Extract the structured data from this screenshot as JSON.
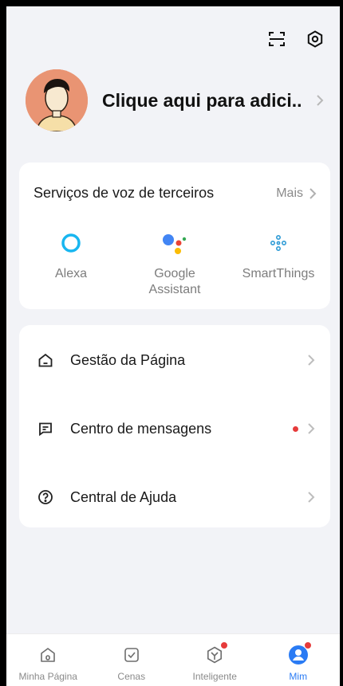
{
  "header": {
    "icons": [
      "scan-icon",
      "settings-icon"
    ]
  },
  "profile": {
    "name": "Clique aqui para adici..."
  },
  "voice_services": {
    "title": "Serviços de voz de terceiros",
    "more_label": "Mais",
    "items": [
      {
        "label": "Alexa",
        "icon": "alexa-icon"
      },
      {
        "label": "Google Assistant",
        "icon": "google-assistant-icon"
      },
      {
        "label": "SmartThings",
        "icon": "smartthings-icon"
      }
    ]
  },
  "menu": {
    "items": [
      {
        "label": "Gestão da Página",
        "icon": "home-icon",
        "badge": false
      },
      {
        "label": "Centro de mensagens",
        "icon": "message-icon",
        "badge": true
      },
      {
        "label": "Central de Ajuda",
        "icon": "help-icon",
        "badge": false
      }
    ]
  },
  "tabbar": {
    "tabs": [
      {
        "label": "Minha Página",
        "icon": "home-tab-icon",
        "active": false,
        "badge": false
      },
      {
        "label": "Cenas",
        "icon": "scenes-tab-icon",
        "active": false,
        "badge": false
      },
      {
        "label": "Inteligente",
        "icon": "smart-tab-icon",
        "active": false,
        "badge": true
      },
      {
        "label": "Mim",
        "icon": "me-tab-icon",
        "active": true,
        "badge": true
      }
    ]
  },
  "colors": {
    "accent": "#2a7bf4",
    "badge": "#e63b3b",
    "background": "#f2f3f7"
  }
}
